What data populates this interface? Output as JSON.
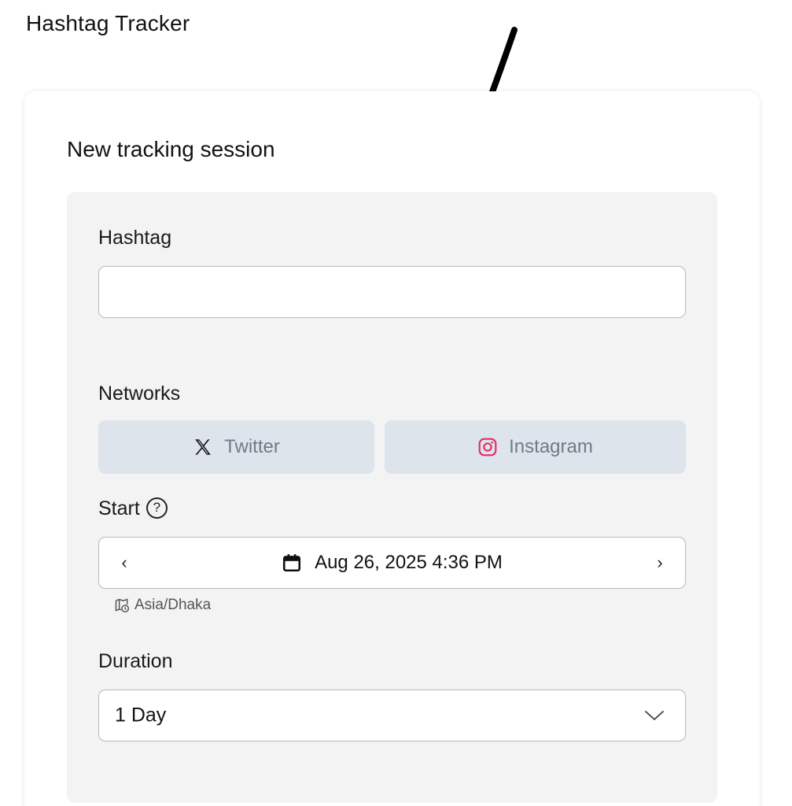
{
  "header": {
    "title": "Hashtag Tracker"
  },
  "card": {
    "title": "New tracking session"
  },
  "form": {
    "hashtag": {
      "label": "Hashtag",
      "value": "",
      "placeholder": ""
    },
    "networks": {
      "label": "Networks",
      "options": [
        {
          "label": "Twitter",
          "icon": "x-logo-icon"
        },
        {
          "label": "Instagram",
          "icon": "instagram-icon"
        }
      ]
    },
    "start": {
      "label": "Start",
      "help_icon": "question-circle-icon",
      "value": "Aug 26, 2025 4:36 PM",
      "prev_symbol": "‹",
      "next_symbol": "›",
      "timezone": "Asia/Dhaka"
    },
    "duration": {
      "label": "Duration",
      "value": "1 Day"
    }
  },
  "colors": {
    "network_button_bg": "#dde4eb",
    "network_text": "#707b86",
    "instagram_icon": "#e1306c",
    "panel_bg": "#f3f3f3"
  }
}
